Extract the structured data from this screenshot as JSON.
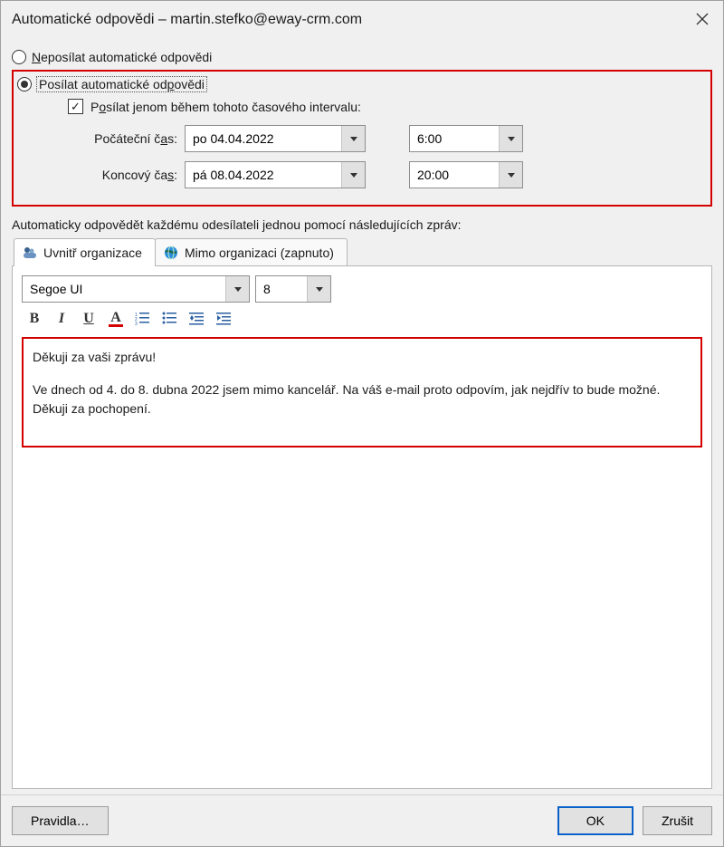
{
  "window": {
    "title": "Automatické odpovědi – martin.stefko@eway-crm.com"
  },
  "radios": {
    "dont_send": "Neposílat automatické odpovědi",
    "send": "Posílat automatické odpovědi"
  },
  "range_checkbox": {
    "label": "Posílat jenom během tohoto časového intervalu:"
  },
  "labels": {
    "start": "Počáteční čas:",
    "end": "Koncový čas:"
  },
  "times": {
    "start_date": "po 04.04.2022",
    "start_time": "6:00",
    "end_date": "pá 08.04.2022",
    "end_time": "20:00"
  },
  "instruction": "Automaticky odpovědět každému odesílateli jednou pomocí následujících zpráv:",
  "tabs": {
    "inside": "Uvnitř organizace",
    "outside": "Mimo organizaci (zapnuto)"
  },
  "editor": {
    "font": "Segoe UI",
    "size": "8",
    "line1": "Děkuji za vaši zprávu!",
    "line2": "Ve dnech od 4. do 8. dubna 2022 jsem mimo kancelář. Na váš e-mail proto odpovím, jak nejdřív to bude možné. Děkuji za pochopení."
  },
  "buttons": {
    "rules": "Pravidla…",
    "ok": "OK",
    "cancel": "Zrušit"
  },
  "glyphs": {
    "bold": "B",
    "italic": "I",
    "underline": "U",
    "fontcolor": "A",
    "check": "✓"
  }
}
